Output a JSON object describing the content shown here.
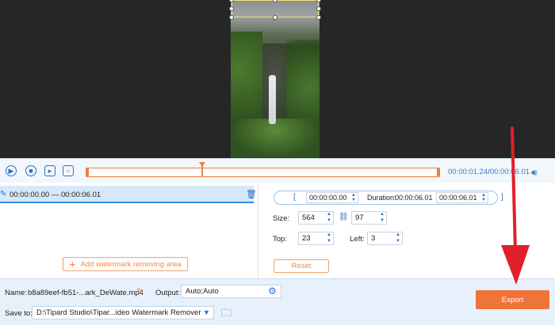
{
  "playback": {
    "current_time": "00:00:01.24",
    "separator": "/",
    "total_time": "00:00:06.01"
  },
  "segment": {
    "range": "00:00:00.00 — 00:00:06.01"
  },
  "add_area_label": "Add watermark removing area",
  "timing": {
    "start": "00:00:00.00",
    "duration_label": "Duration:",
    "duration": "00:00:06.01",
    "end": "00:00:06.01",
    "open_bracket": "[",
    "close_bracket": "]"
  },
  "size": {
    "label": "Size:",
    "width": "564",
    "height": "97"
  },
  "position": {
    "top_label": "Top:",
    "top": "23",
    "left_label": "Left:",
    "left": "3"
  },
  "reset_label": "Reset",
  "bottom": {
    "name_label": "Name:",
    "name_value": "b8a89eef-fb51-...ark_DeWate.mp4",
    "output_label": "Output:",
    "output_value": "Auto;Auto",
    "save_label": "Save to:",
    "save_value": "D:\\Tipard Studio\\Tipar...ideo Watermark Remover",
    "export_label": "Export"
  },
  "colors": {
    "accent_blue": "#2a6fc7",
    "accent_orange": "#f0743a",
    "annotation_arrow": "#e0202a"
  },
  "icons": [
    "play-icon",
    "stop-icon",
    "next-frame-icon",
    "frame-icon",
    "volume-icon",
    "edit-icon",
    "trash-icon",
    "plus-icon",
    "link-icon",
    "pencil-icon",
    "gear-icon",
    "dropdown-icon",
    "folder-icon"
  ]
}
